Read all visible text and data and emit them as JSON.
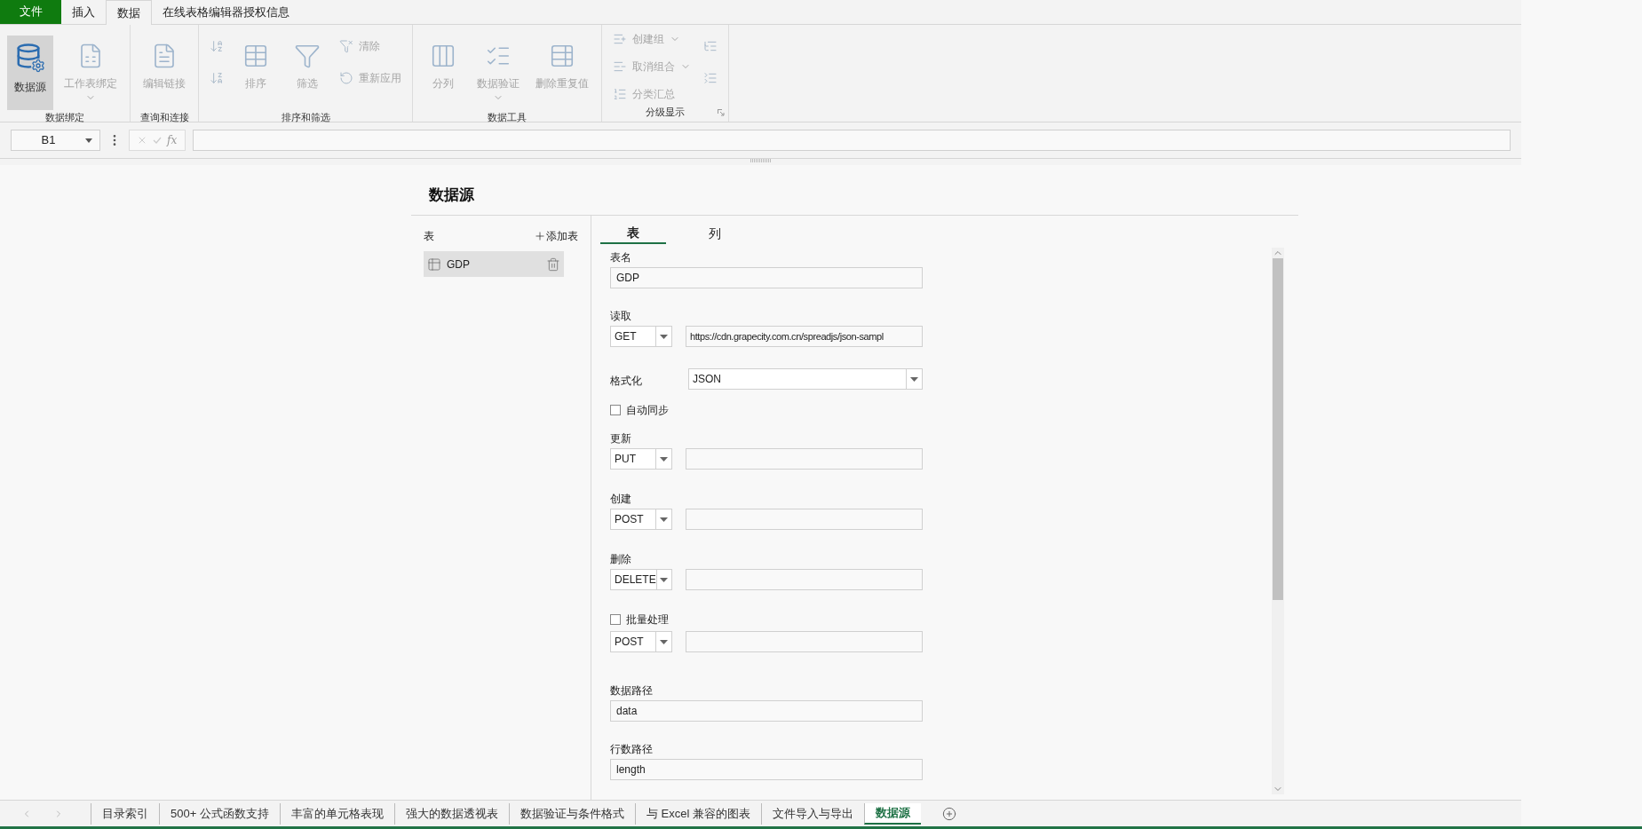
{
  "ribbon_tabs": [
    {
      "label": "文件",
      "kind": "file",
      "selected": false
    },
    {
      "label": "插入",
      "kind": "tab",
      "selected": false
    },
    {
      "label": "数据",
      "kind": "tab",
      "selected": true
    },
    {
      "label": "在线表格编辑器授权信息",
      "kind": "tab",
      "selected": false
    }
  ],
  "ribbon": {
    "groups": [
      {
        "label": "数据绑定",
        "launcher": false,
        "columns": [
          [
            {
              "label": "数据源",
              "pressed": true,
              "disabled": false,
              "dropdown": false
            }
          ],
          [
            {
              "label": "工作表绑定",
              "pressed": false,
              "disabled": true,
              "dropdown": true
            }
          ]
        ]
      },
      {
        "label": "查询和连接",
        "launcher": false,
        "columns": [
          [
            {
              "label": "编辑链接",
              "pressed": false,
              "disabled": true,
              "dropdown": false
            }
          ]
        ]
      },
      {
        "label": "排序和筛选",
        "launcher": false,
        "columns": [
          [
            {
              "pressed": false,
              "disabled": true,
              "dropdown": false
            },
            {
              "pressed": false,
              "disabled": true,
              "dropdown": false
            }
          ],
          [
            {
              "label": "排序",
              "pressed": false,
              "disabled": true,
              "dropdown": false
            }
          ],
          [
            {
              "label": "筛选",
              "pressed": false,
              "disabled": true,
              "dropdown": false
            }
          ],
          [
            {
              "label": "清除",
              "pressed": false,
              "disabled": true,
              "dropdown": false
            },
            {
              "label": "重新应用",
              "pressed": false,
              "disabled": true,
              "dropdown": false
            }
          ]
        ]
      },
      {
        "label": "数据工具",
        "launcher": false,
        "columns": [
          [
            {
              "label": "分列",
              "pressed": false,
              "disabled": true,
              "dropdown": false
            }
          ],
          [
            {
              "label": "数据验证",
              "pressed": false,
              "disabled": true,
              "dropdown": true
            }
          ],
          [
            {
              "label": "删除重复值",
              "pressed": false,
              "disabled": true,
              "dropdown": false
            }
          ]
        ]
      },
      {
        "label": "分级显示",
        "launcher": true,
        "columns": [
          [
            {
              "label": "创建组",
              "pressed": false,
              "disabled": true,
              "dropdown": true
            },
            {
              "label": "取消组合",
              "pressed": false,
              "disabled": true,
              "dropdown": true
            },
            {
              "label": "分类汇总",
              "pressed": false,
              "disabled": true,
              "dropdown": false
            }
          ],
          [
            {
              "pressed": false,
              "disabled": true,
              "dropdown": false
            },
            {
              "pressed": false,
              "disabled": true,
              "dropdown": false
            }
          ]
        ]
      }
    ]
  },
  "formula_bar": {
    "cell_ref": "B1",
    "fx": "fx"
  },
  "panel": {
    "title": "数据源",
    "tables_header": {
      "label": "表",
      "add": "添加表"
    },
    "tables": [
      {
        "name": "GDP",
        "selected": true
      }
    ],
    "tabs": [
      {
        "label": "表",
        "selected": true
      },
      {
        "label": "列",
        "selected": false
      }
    ],
    "fields": [
      {
        "kind": "text",
        "label": "表名",
        "value": "GDP"
      },
      {
        "kind": "method_url",
        "label": "读取",
        "method": "GET",
        "url": "https://cdn.grapecity.com.cn/spreadjs/json-sampl"
      },
      {
        "kind": "select",
        "label": "格式化",
        "value": "JSON"
      },
      {
        "kind": "checkbox",
        "label": "自动同步",
        "checked": false
      },
      {
        "kind": "method_url",
        "label": "更新",
        "method": "PUT"
      },
      {
        "kind": "method_url",
        "label": "创建",
        "method": "POST"
      },
      {
        "kind": "method_url",
        "label": "删除",
        "method": "DELETE"
      },
      {
        "kind": "checkbox_method_url",
        "label": "批量处理",
        "checked": false,
        "method": "POST"
      },
      {
        "kind": "text",
        "label": "数据路径",
        "value": "data"
      },
      {
        "kind": "text",
        "label": "行数路径",
        "value": "length"
      }
    ]
  },
  "sheet_tabs": [
    {
      "label": "目录索引",
      "selected": false
    },
    {
      "label": "500+ 公式函数支持",
      "selected": false
    },
    {
      "label": "丰富的单元格表现",
      "selected": false
    },
    {
      "label": "强大的数据透视表",
      "selected": false
    },
    {
      "label": "数据验证与条件格式",
      "selected": false
    },
    {
      "label": "与 Excel 兼容的图表",
      "selected": false
    },
    {
      "label": "文件导入与导出",
      "selected": false
    },
    {
      "label": "数据源",
      "selected": true
    }
  ]
}
